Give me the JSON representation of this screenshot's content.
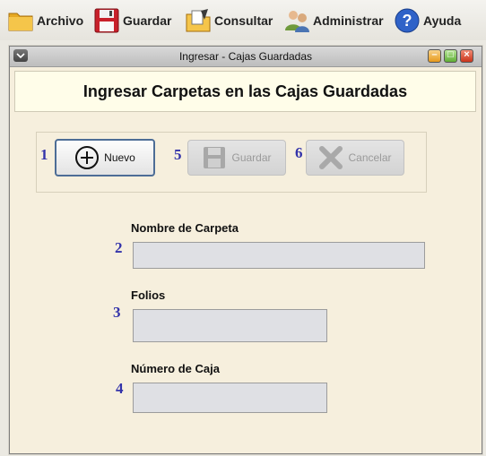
{
  "menubar": {
    "items": [
      {
        "label": "Archivo",
        "icon": "folder-icon"
      },
      {
        "label": "Guardar",
        "icon": "floppy-disk-icon"
      },
      {
        "label": "Consultar",
        "icon": "search-folder-icon"
      },
      {
        "label": "Administrar",
        "icon": "users-icon"
      },
      {
        "label": "Ayuda",
        "icon": "help-icon"
      }
    ]
  },
  "window": {
    "title": "Ingresar - Cajas Guardadas",
    "header": "Ingresar Carpetas en las Cajas Guardadas"
  },
  "toolbar": {
    "nuevo": {
      "number": "1",
      "label": "Nuevo",
      "icon": "plus-circle-icon"
    },
    "guardar": {
      "number": "5",
      "label": "Guardar",
      "icon": "floppy-disk-icon"
    },
    "cancelar": {
      "number": "6",
      "label": "Cancelar",
      "icon": "x-icon"
    }
  },
  "form": {
    "nombre": {
      "number": "2",
      "label": "Nombre de Carpeta",
      "value": ""
    },
    "folios": {
      "number": "3",
      "label": "Folios",
      "value": ""
    },
    "caja": {
      "number": "4",
      "label": "Número de Caja",
      "value": ""
    }
  },
  "colors": {
    "accent_number": "#3333aa",
    "panel_background": "#f6efdd",
    "header_background": "#fffde9",
    "field_background": "#dfe0e4"
  }
}
